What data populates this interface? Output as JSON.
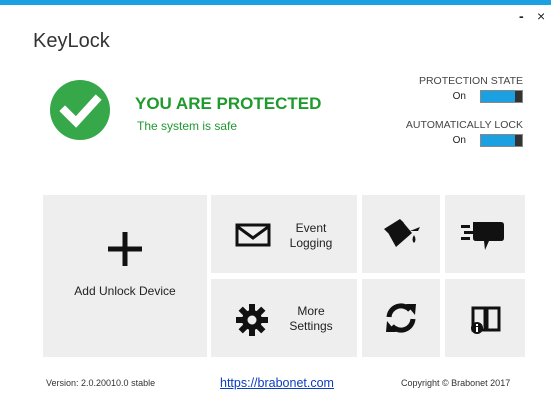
{
  "window": {
    "title": "KeyLock",
    "minimize_label": "-",
    "close_label": "×"
  },
  "status": {
    "headline": "YOU ARE PROTECTED",
    "subtext": "The system is safe",
    "icon": "checkmark-circle-icon",
    "color": "#36a84a"
  },
  "options": {
    "protection_state": {
      "label": "PROTECTION STATE",
      "value": "On"
    },
    "auto_lock": {
      "label": "AUTOMATICALLY LOCK",
      "value": "On"
    }
  },
  "tiles": {
    "add_device": {
      "label": "Add Unlock Device",
      "icon": "plus-icon"
    },
    "event_logging": {
      "line1": "Event",
      "line2": "Logging",
      "icon": "envelope-icon"
    },
    "more_settings": {
      "line1": "More",
      "line2": "Settings",
      "icon": "gear-icon"
    },
    "paint": {
      "icon": "paint-bucket-icon"
    },
    "feedback": {
      "icon": "speech-bubble-icon"
    },
    "update": {
      "icon": "refresh-icon"
    },
    "help": {
      "icon": "book-info-icon"
    }
  },
  "footer": {
    "version": "Version: 2.0.20010.0 stable",
    "link": "https://brabonet.com",
    "copyright": "Copyright © Brabonet 2017"
  },
  "colors": {
    "accent": "#1ba1e2",
    "protected_green": "#1f9a2e",
    "tile_bg": "#eeeeee"
  }
}
